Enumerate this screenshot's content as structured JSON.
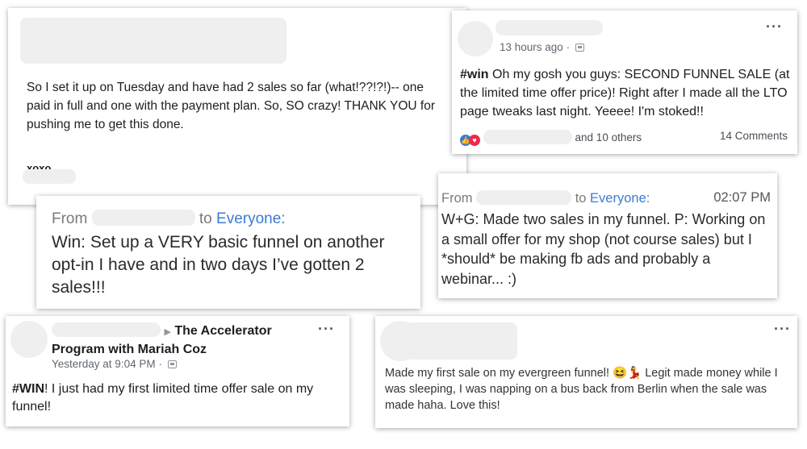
{
  "card_a": {
    "text": "So I set it up on Tuesday and have had 2 sales so far (what!??!?!)-- one paid in full and one with the payment plan. So, SO crazy! THANK YOU for pushing me to get this done.",
    "signoff": "xoxo"
  },
  "card_b": {
    "timestamp": "13 hours ago",
    "separator": "·",
    "hashtag": "#win",
    "post": " Oh my gosh you guys: SECOND FUNNEL SALE (at the limited time offer price)! Right after I made all the LTO page tweaks last night. Yeeee! I'm stoked!!",
    "reactions_suffix": "and 10 others",
    "comments": "14 Comments",
    "more": "···"
  },
  "card_c": {
    "from": "From",
    "to": "to",
    "recipient": "Everyone:",
    "message": "Win: Set up a VERY basic funnel on another opt-in I have and in two days I’ve gotten 2 sales!!!"
  },
  "card_d": {
    "from": "From",
    "to": "to",
    "recipient": "Everyone:",
    "time": "02:07 PM",
    "message": "W+G: Made two sales in my funnel. P: Working on a small offer for my shop (not course sales) but I *should* be making fb ads and probably a webinar... :)"
  },
  "card_e": {
    "arrow": "▶",
    "group": "The Accelerator Program with Mariah Coz",
    "timestamp": "Yesterday at 9:04 PM",
    "separator": "·",
    "hashtag": "#WIN",
    "post": "! I just had my first limited time offer sale on my funnel!",
    "more": "···"
  },
  "card_f": {
    "post_before": "Made my first sale on my evergreen funnel! ",
    "emoji": "😆💃",
    "post_after": " Legit made money while I was sleeping, I was napping on a bus back from Berlin when the sale was made haha. Love this!",
    "more": "···"
  }
}
